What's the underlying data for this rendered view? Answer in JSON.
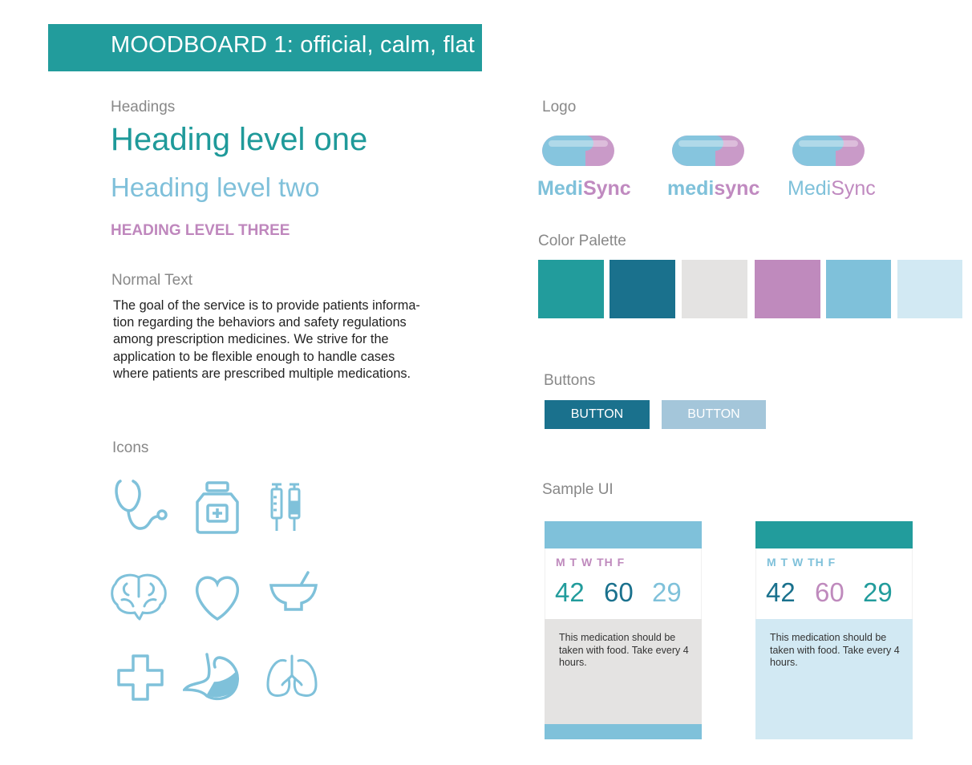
{
  "banner": {
    "title": "MOODBOARD 1: official, calm, flat"
  },
  "labels": {
    "headings": "Headings",
    "normal_text": "Normal Text",
    "icons": "Icons",
    "logo": "Logo",
    "color_palette": "Color Palette",
    "buttons": "Buttons",
    "sample_ui": "Sample UI"
  },
  "headings": {
    "h1": "Heading level one",
    "h2": "Heading level two",
    "h3": "HEADING LEVEL THREE"
  },
  "normal_text": {
    "lines": [
      "The goal of the service is to provide patients informa-",
      "tion regarding the behaviors and safety regulations",
      "among prescription medicines. We strive for the",
      "application to be flexible enough to handle cases",
      "where patients are prescribed multiple medications."
    ]
  },
  "icons": [
    "stethoscope-icon",
    "medicine-bottle-icon",
    "syringes-icon",
    "brain-icon",
    "heart-icon",
    "mortar-pestle-icon",
    "medical-cross-icon",
    "stomach-icon",
    "lungs-icon"
  ],
  "logos": [
    {
      "part1": "Medi",
      "part2": "Sync"
    },
    {
      "part1": "medi",
      "part2": "sync"
    },
    {
      "part1": "Medi",
      "part2": "Sync"
    }
  ],
  "palette": [
    "#229c9c",
    "#1a718d",
    "#e4e3e2",
    "#bf8abd",
    "#7fc1da",
    "#d2e9f3"
  ],
  "colors": {
    "teal": "#229c9c",
    "dark_teal": "#1a718d",
    "light_blue": "#7fc1da",
    "pink": "#bf8abd",
    "pale_blue": "#d2e9f3",
    "grey": "#e4e3e2"
  },
  "buttons": {
    "primary": "BUTTON",
    "secondary": "BUTTON"
  },
  "sample_ui": {
    "cards": [
      {
        "days": "M T W TH F",
        "values": [
          "42",
          "60",
          "29"
        ],
        "message": "This medication should be taken with food. Take every 4 hours."
      },
      {
        "days": "M T W TH F",
        "values": [
          "42",
          "60",
          "29"
        ],
        "message": "This medication should be taken with food. Take every 4 hours."
      }
    ]
  }
}
